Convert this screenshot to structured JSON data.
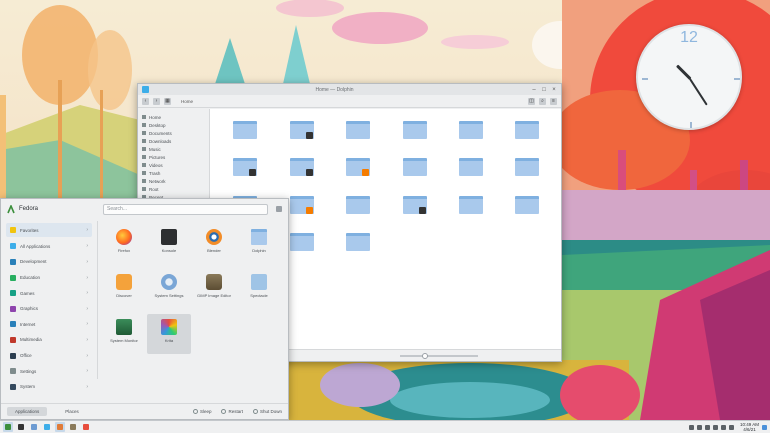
{
  "clock": {
    "hour_label": "12",
    "face_text": ""
  },
  "file_manager": {
    "title": "Home — Dolphin",
    "breadcrumb": "Home",
    "places": [
      "Home",
      "Desktop",
      "Documents",
      "Downloads",
      "Music",
      "Pictures",
      "Videos",
      "Trash",
      "Network",
      "Root",
      "Recent"
    ],
    "folders": [
      {
        "label": "",
        "badge": ""
      },
      {
        "label": "",
        "badge": "dark"
      },
      {
        "label": "",
        "badge": ""
      },
      {
        "label": "",
        "badge": ""
      },
      {
        "label": "",
        "badge": ""
      },
      {
        "label": "",
        "badge": ""
      },
      {
        "label": "",
        "badge": "dark"
      },
      {
        "label": "",
        "badge": "dark"
      },
      {
        "label": "",
        "badge": "orange"
      },
      {
        "label": "",
        "badge": ""
      },
      {
        "label": "",
        "badge": ""
      },
      {
        "label": "",
        "badge": ""
      },
      {
        "label": "",
        "badge": ""
      },
      {
        "label": "",
        "badge": "orange"
      },
      {
        "label": "",
        "badge": ""
      },
      {
        "label": "",
        "badge": "dark"
      },
      {
        "label": "",
        "badge": ""
      },
      {
        "label": "",
        "badge": ""
      },
      {
        "label": "",
        "badge": ""
      },
      {
        "label": "",
        "badge": ""
      },
      {
        "label": "",
        "badge": ""
      }
    ]
  },
  "launcher": {
    "user": "Fedora",
    "search_placeholder": "Search...",
    "categories": [
      {
        "label": "Favorites",
        "color": "#f1c40f"
      },
      {
        "label": "All Applications",
        "color": "#3daee9"
      },
      {
        "label": "Development",
        "color": "#2980b9"
      },
      {
        "label": "Education",
        "color": "#27ae60"
      },
      {
        "label": "Games",
        "color": "#16a085"
      },
      {
        "label": "Graphics",
        "color": "#8e44ad"
      },
      {
        "label": "Internet",
        "color": "#2980b9"
      },
      {
        "label": "Multimedia",
        "color": "#c0392b"
      },
      {
        "label": "Office",
        "color": "#2c3e50"
      },
      {
        "label": "Settings",
        "color": "#7f8c8d"
      },
      {
        "label": "System",
        "color": "#34495e"
      }
    ],
    "apps": [
      {
        "label": "Firefox",
        "icon": "firefox-icon"
      },
      {
        "label": "Konsole",
        "icon": "terminal-icon"
      },
      {
        "label": "Blender",
        "icon": "blender-icon"
      },
      {
        "label": "Dolphin",
        "icon": "folder-icon"
      },
      {
        "label": "Discover",
        "icon": "store-icon"
      },
      {
        "label": "System Settings",
        "icon": "settings-icon"
      },
      {
        "label": "GIMP Image Editor",
        "icon": "gimp-icon"
      },
      {
        "label": "Spectacle",
        "icon": "screenshot-icon"
      },
      {
        "label": "System Monitor",
        "icon": "monitor-icon"
      },
      {
        "label": "Krita",
        "icon": "krita-icon"
      }
    ],
    "tabs": [
      "Applications",
      "Places"
    ],
    "actions": [
      "Sleep",
      "Restart",
      "Shut Down"
    ]
  },
  "panel": {
    "time": "10:49 AM",
    "date": "4/6/21"
  }
}
